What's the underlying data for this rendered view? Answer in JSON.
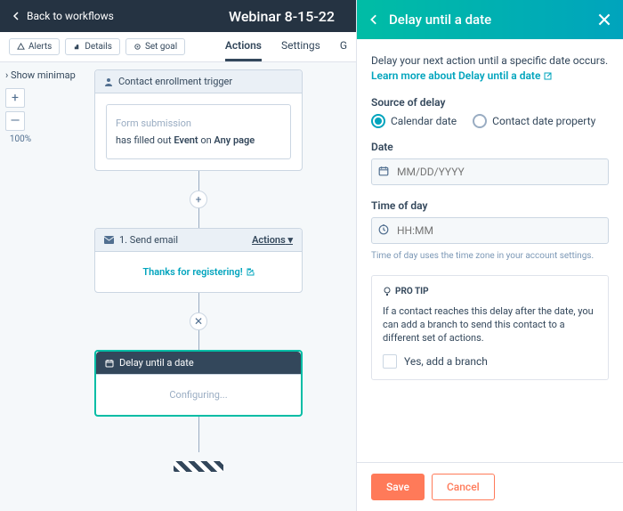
{
  "topbar": {
    "back": "Back to workflows",
    "title": "Webinar 8-15-22"
  },
  "toolbar": {
    "alerts": "Alerts",
    "details": "Details",
    "goal": "Set goal"
  },
  "tabs": {
    "actions": "Actions",
    "settings": "Settings",
    "other": "G"
  },
  "side": {
    "minimap": "Show minimap",
    "plus": "+",
    "minus": "—",
    "zoom": "100%"
  },
  "c1": {
    "head": "Contact enrollment trigger",
    "form": "Form submission",
    "line_pre": "has filled out ",
    "b1": "Event",
    "mid": " on ",
    "b2": "Any page"
  },
  "c2": {
    "head": "1. Send email",
    "actions": "Actions",
    "body": "Thanks for registering!"
  },
  "c3": {
    "head": "Delay until a date",
    "body": "Configuring..."
  },
  "panel": {
    "title": "Delay until a date",
    "desc": "Delay your next action until a specific date occurs. ",
    "learn": "Learn more about Delay until a date",
    "src_lbl": "Source of delay",
    "r1": "Calendar date",
    "r2": "Contact date property",
    "date_lbl": "Date",
    "date_ph": "MM/DD/YYYY",
    "time_lbl": "Time of day",
    "time_ph": "HH:MM",
    "hint": "Time of day uses the time zone in your account settings.",
    "tip_h": "PRO TIP",
    "tip_b": "If a contact reaches this delay after the date, you can add a branch to send this contact to a different set of actions.",
    "tip_chk": "Yes, add a branch",
    "save": "Save",
    "cancel": "Cancel"
  }
}
